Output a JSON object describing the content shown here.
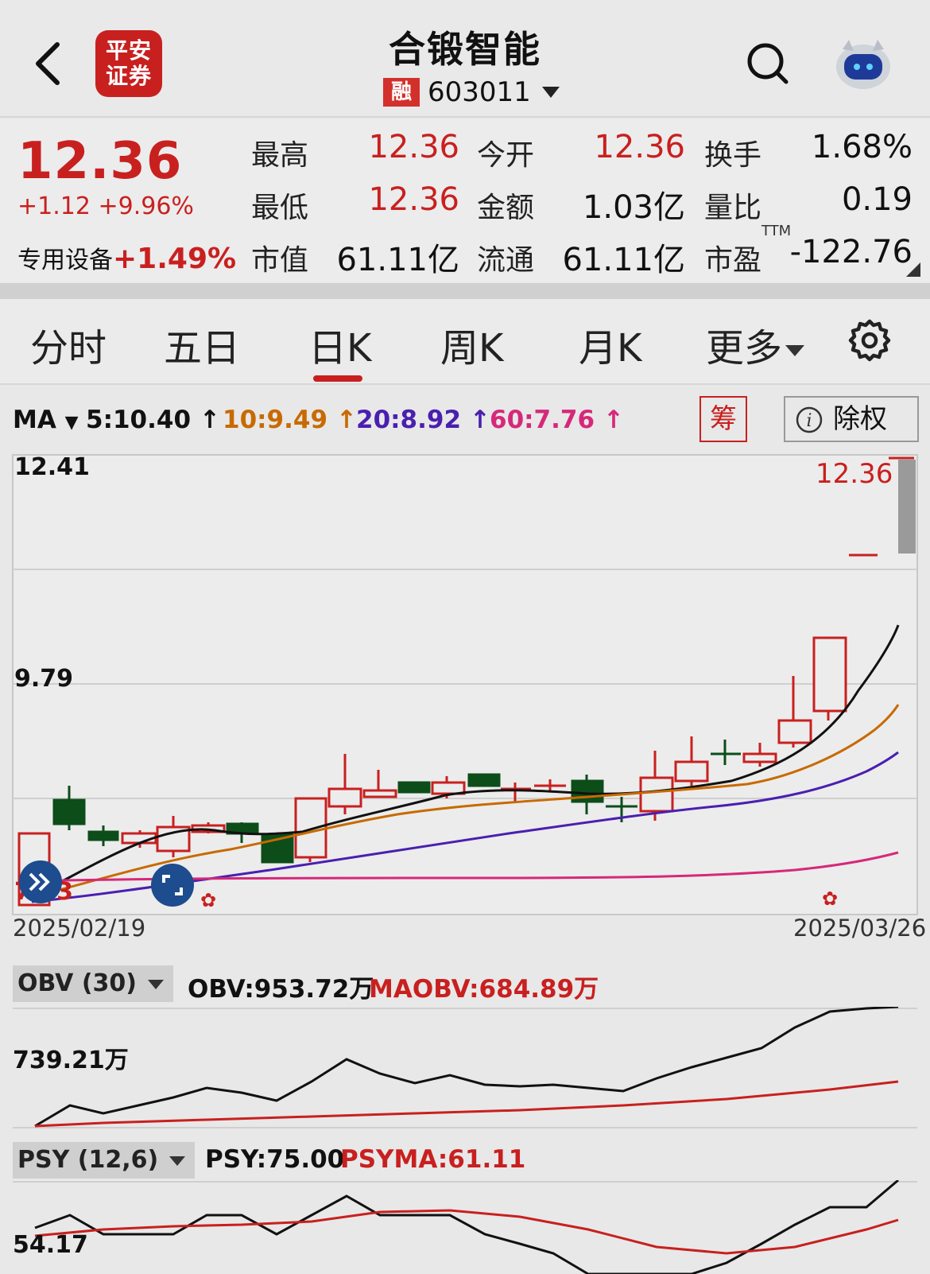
{
  "header": {
    "logo_text_line1": "平安",
    "logo_text_line2": "证券",
    "stock_name": "合锻智能",
    "margin_badge": "融",
    "stock_code": "603011"
  },
  "quote": {
    "price": "12.36",
    "change": "+1.12 +9.96%",
    "sector_name": "专用设备",
    "sector_change": "+1.49%",
    "rows": [
      [
        {
          "label": "最高",
          "value": "12.36"
        },
        {
          "label": "今开",
          "value": "12.36"
        },
        {
          "label": "换手",
          "value": "1.68%"
        }
      ],
      [
        {
          "label": "最低",
          "value": "12.36"
        },
        {
          "label": "金额",
          "value": "1.03亿"
        },
        {
          "label": "量比",
          "value": "0.19"
        }
      ],
      [
        {
          "label": "市值",
          "value": "61.11亿"
        },
        {
          "label": "流通",
          "value": "61.11亿"
        },
        {
          "label": "市盈",
          "value": "-122.76"
        }
      ]
    ],
    "pe_superscript": "TTM"
  },
  "tabs": {
    "items": [
      "分时",
      "五日",
      "日K",
      "周K",
      "月K",
      "更多"
    ],
    "active": "日K"
  },
  "ma": {
    "label": "MA",
    "ma5": "5:10.40 ↑",
    "ma10": "10:9.49 ↑",
    "ma20": "20:8.92 ↑",
    "ma60": "60:7.76 ↑",
    "chip_button": "筹",
    "exright_button": "除权",
    "colors": {
      "ma5": "#111111",
      "ma10": "#c86a00",
      "ma20": "#4a1fb0",
      "ma60": "#d6287a",
      "up": "#c8201f",
      "down": "#0c4d1a"
    }
  },
  "kchart": {
    "y_top_label": "12.41",
    "y_mid_label": "9.79",
    "y_bottom_label": "7.23",
    "last_price_label": "12.36",
    "start_date": "2025/02/19",
    "end_date": "2025/03/26"
  },
  "obv": {
    "selector": "OBV (30)",
    "value": "OBV:953.72万",
    "ma_value": "MAOBV:684.89万",
    "axis_label": "739.21万"
  },
  "psy": {
    "selector": "PSY (12,6)",
    "value": "PSY:75.00",
    "ma_value": "PSYMA:61.11",
    "axis_label": "54.17"
  }
}
